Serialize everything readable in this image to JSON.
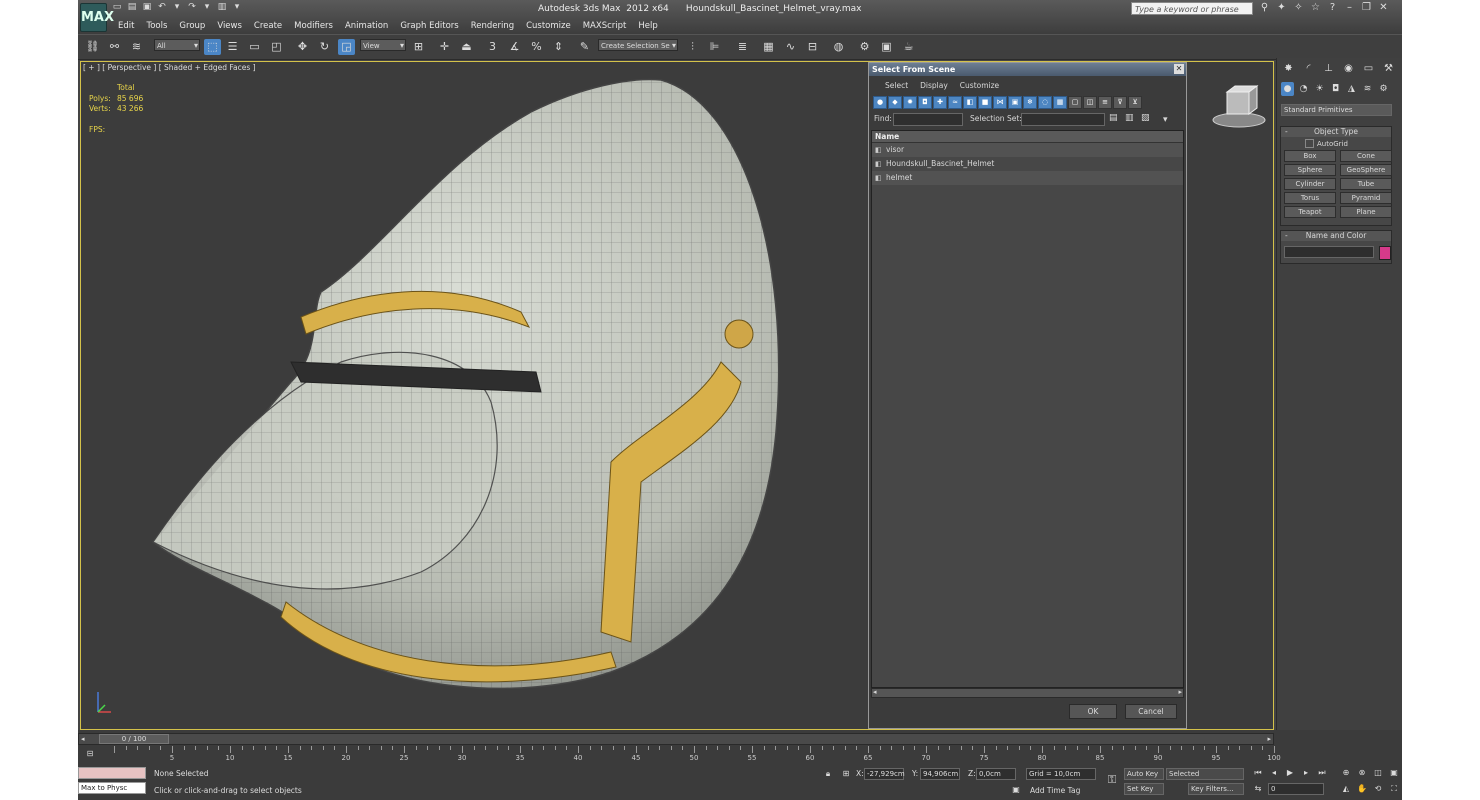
{
  "app": {
    "window_title": "Autodesk 3ds Max  2012 x64      Houndskull_Bascinet_Helmet_vray.max",
    "search_placeholder": "Type a keyword or phrase",
    "logo": "MAX"
  },
  "menu": [
    "Edit",
    "Tools",
    "Group",
    "Views",
    "Create",
    "Modifiers",
    "Animation",
    "Graph Editors",
    "Rendering",
    "Customize",
    "MAXScript",
    "Help"
  ],
  "toolbar": {
    "filter_dropdown": "All",
    "view_dropdown": "View",
    "selection_set_dropdown": "Create Selection Se",
    "snap_label_3": "3"
  },
  "viewport": {
    "label": "[ + ] [ Perspective ] [ Shaded + Edged Faces ]",
    "stats_header": "Total",
    "polys_label": "Polys:",
    "polys_value": "85 696",
    "verts_label": "Verts:",
    "verts_value": "43 266",
    "fps_label": "FPS:"
  },
  "dialog": {
    "title": "Select From Scene",
    "menu": [
      "Select",
      "Display",
      "Customize"
    ],
    "find_label": "Find:",
    "selection_set_label": "Selection Set:",
    "column_name": "Name",
    "objects": [
      "visor",
      "Houndskull_Bascinet_Helmet",
      "helmet"
    ],
    "ok_label": "OK",
    "cancel_label": "Cancel"
  },
  "command_panel": {
    "category_dropdown": "Standard Primitives",
    "object_type_header": "Object Type",
    "autogrid_label": "AutoGrid",
    "primitives": [
      "Box",
      "Cone",
      "Sphere",
      "GeoSphere",
      "Cylinder",
      "Tube",
      "Torus",
      "Pyramid",
      "Teapot",
      "Plane"
    ],
    "name_color_header": "Name and Color",
    "object_color": "#d63a8a"
  },
  "timeline": {
    "frame_indicator": "0 / 100",
    "ticks": [
      "5",
      "10",
      "15",
      "20",
      "25",
      "30",
      "35",
      "40",
      "45",
      "50",
      "55",
      "60",
      "65",
      "70",
      "75",
      "80",
      "85",
      "90",
      "95",
      "100"
    ]
  },
  "status": {
    "selection": "None Selected",
    "prompt": "Click or click-and-drag to select objects",
    "script_listener": "Max to Physc",
    "x_label": "X:",
    "x_value": "-27,929cm",
    "y_label": "Y:",
    "y_value": "94,906cm",
    "z_label": "Z:",
    "z_value": "0,0cm",
    "grid": "Grid = 10,0cm",
    "add_time_tag": "Add Time Tag",
    "auto_key": "Auto Key",
    "set_key": "Set Key",
    "key_mode": "Selected",
    "key_filters": "Key Filters...",
    "frame_field": "0"
  }
}
